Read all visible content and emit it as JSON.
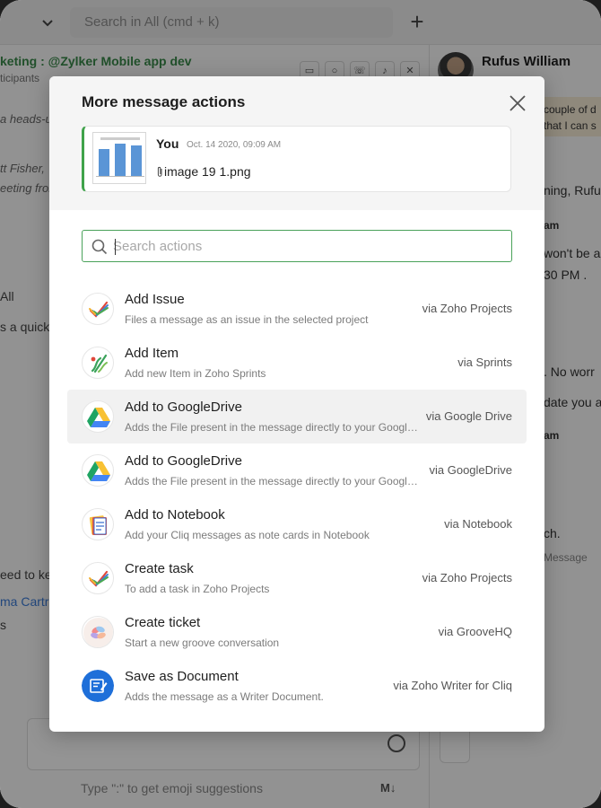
{
  "background": {
    "search_placeholder": "Search in All (cmd + k)",
    "plus": "+",
    "channel_title": "keting : @Zylker Mobile app dev",
    "channel_sub": "ticipants",
    "frag_heads": "a heads-u",
    "frag_fisher": "tt Fisher,",
    "frag_meeting": "eeting fror",
    "frag_all": "All",
    "frag_quick": "s a quick",
    "frag_need": "eed to ke",
    "frag_name": "ma Cartr",
    "frag_s": "s",
    "compose_hint": "Type \":\" to get emoji suggestions",
    "markdown": "M↓",
    "user_name": "Rufus William",
    "r_couple": "couple of d",
    "r_thatican": "that I can s",
    "r_ning": "ning, Rufus",
    "r_am1": "am",
    "r_wont": "won't be a",
    "r_time": "30 PM .",
    "r_noworry": ". No worr",
    "r_update": "date you a",
    "r_am2": "am",
    "r_ch": "ch.",
    "r_message": "Message"
  },
  "modal": {
    "title": "More message actions",
    "message": {
      "sender": "You",
      "timestamp": "Oct. 14 2020, 09:09 AM",
      "file_name": "image 19 1.png"
    },
    "search_placeholder": "Search actions",
    "actions": [
      {
        "title": "Add Issue",
        "desc": "Files a message as an issue in the selected project",
        "via": "via Zoho Projects",
        "icon": "zoho-projects-icon"
      },
      {
        "title": "Add Item",
        "desc": "Add new Item in Zoho Sprints",
        "via": "via Sprints",
        "icon": "sprints-icon"
      },
      {
        "title": "Add to GoogleDrive",
        "desc": "Adds the File present in the message directly to your Google Drive",
        "via": "via Google Drive",
        "icon": "google-drive-icon"
      },
      {
        "title": "Add to GoogleDrive",
        "desc": "Adds the File present in the message directly to your Google Drive",
        "via": "via GoogleDrive",
        "icon": "google-drive-icon"
      },
      {
        "title": "Add to Notebook",
        "desc": "Add your Cliq messages as note cards in Notebook",
        "via": "via Notebook",
        "icon": "notebook-icon"
      },
      {
        "title": "Create task",
        "desc": "To add a task in Zoho Projects",
        "via": "via Zoho Projects",
        "icon": "zoho-projects-icon"
      },
      {
        "title": "Create ticket",
        "desc": "Start a new groove conversation",
        "via": "via GrooveHQ",
        "icon": "groovehq-icon"
      },
      {
        "title": "Save as Document",
        "desc": "Adds the message as a Writer Document.",
        "via": "via Zoho Writer for Cliq",
        "icon": "zoho-writer-icon"
      }
    ]
  },
  "colors": {
    "accent_green": "#3fa24a",
    "link_blue": "#3b7bd8"
  }
}
